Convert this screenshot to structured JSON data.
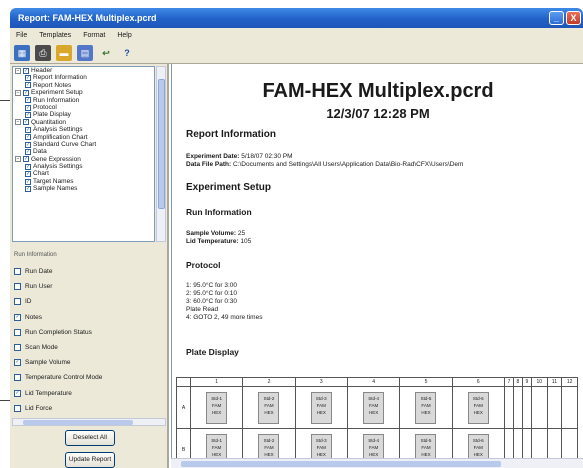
{
  "window": {
    "title": "Report: FAM-HEX Multiplex.pcrd",
    "minimize": "_",
    "close": "X"
  },
  "menu": [
    "File",
    "Templates",
    "Format",
    "Help"
  ],
  "toolbar": [
    {
      "name": "grid-icon",
      "glyph": "▦",
      "cls": "grid"
    },
    {
      "name": "print-icon",
      "glyph": "⎙",
      "cls": "print"
    },
    {
      "name": "open-folder-icon",
      "glyph": "▬",
      "cls": "folder"
    },
    {
      "name": "chart-icon",
      "glyph": "▤",
      "cls": "chart"
    },
    {
      "name": "arrow-icon",
      "glyph": "↩",
      "cls": "arrow"
    },
    {
      "name": "help-icon",
      "glyph": "?",
      "cls": "help"
    }
  ],
  "tree": [
    {
      "label": "Header",
      "level": 0,
      "expander": "−"
    },
    {
      "label": "Report Information",
      "level": 1
    },
    {
      "label": "Report Notes",
      "level": 1
    },
    {
      "label": "Experiment Setup",
      "level": 0,
      "expander": "−"
    },
    {
      "label": "Run Information",
      "level": 1
    },
    {
      "label": "Protocol",
      "level": 1
    },
    {
      "label": "Plate Display",
      "level": 1
    },
    {
      "label": "Quantitation",
      "level": 0,
      "expander": "−"
    },
    {
      "label": "Analysis Settings",
      "level": 1
    },
    {
      "label": "Amplification Chart",
      "level": 1
    },
    {
      "label": "Standard Curve Chart",
      "level": 1
    },
    {
      "label": "Data",
      "level": 1
    },
    {
      "label": "Gene Expression",
      "level": 0,
      "expander": "−"
    },
    {
      "label": "Analysis Settings",
      "level": 1
    },
    {
      "label": "Chart",
      "level": 1
    },
    {
      "label": "Target Names",
      "level": 1
    },
    {
      "label": "Sample Names",
      "level": 1
    }
  ],
  "run_info_title": "Run Information",
  "options": [
    {
      "label": "Run Date",
      "checked": false
    },
    {
      "label": "Run User",
      "checked": false
    },
    {
      "label": "ID",
      "checked": false
    },
    {
      "label": "Notes",
      "checked": true
    },
    {
      "label": "Run Completion Status",
      "checked": false
    },
    {
      "label": "Scan Mode",
      "checked": false
    },
    {
      "label": "Sample Volume",
      "checked": true
    },
    {
      "label": "Temperature Control Mode",
      "checked": false
    },
    {
      "label": "Lid Temperature",
      "checked": true
    },
    {
      "label": "Lid Force",
      "checked": false
    }
  ],
  "buttons": {
    "deselect": "Deselect All",
    "update": "Update Report"
  },
  "report": {
    "title": "FAM-HEX Multiplex.pcrd",
    "date": "12/3/07 12:28 PM",
    "report_info_heading": "Report Information",
    "experiment_date_label": "Experiment Date:",
    "experiment_date": "5/18/07 02:30 PM",
    "data_file_label": "Data File Path:",
    "data_file": "C:\\Documents and Settings\\All Users\\Application Data\\Bio-Rad\\CFX\\Users\\Dem",
    "experiment_setup_heading": "Experiment Setup",
    "run_info_heading": "Run Information",
    "sample_volume_label": "Sample Volume:",
    "sample_volume": "25",
    "lid_temp_label": "Lid Temperature:",
    "lid_temp": "105",
    "protocol_heading": "Protocol",
    "protocol_steps": [
      "1: 95.0°C for 3:00",
      "2: 95.0°C for 0:10",
      "3: 60.0°C for 0:30",
      "Plate Read",
      "4: GOTO 2, 49 more times"
    ],
    "plate_heading": "Plate Display"
  },
  "plate": {
    "columns": [
      "",
      "1",
      "2",
      "3",
      "4",
      "5",
      "6",
      "7",
      "8",
      "9",
      "10",
      "11",
      "12"
    ],
    "rows": [
      {
        "label": "A",
        "wells": [
          [
            "Std-1",
            "FAM",
            "HEX"
          ],
          [
            "Std-2",
            "FAM",
            "HEX"
          ],
          [
            "Std-3",
            "FAM",
            "HEX"
          ],
          [
            "Std-4",
            "FAM",
            "HEX"
          ],
          [
            "Std-5",
            "FAM",
            "HEX"
          ],
          [
            "Std-6",
            "FAM",
            "HEX"
          ]
        ]
      },
      {
        "label": "B",
        "wells": [
          [
            "Std-1",
            "FAM",
            "HEX"
          ],
          [
            "Std-2",
            "FAM",
            "HEX"
          ],
          [
            "Std-3",
            "FAM",
            "HEX"
          ],
          [
            "Std-4",
            "FAM",
            "HEX"
          ],
          [
            "Std-5",
            "FAM",
            "HEX"
          ],
          [
            "Std-6",
            "FAM",
            "HEX"
          ]
        ]
      }
    ]
  }
}
